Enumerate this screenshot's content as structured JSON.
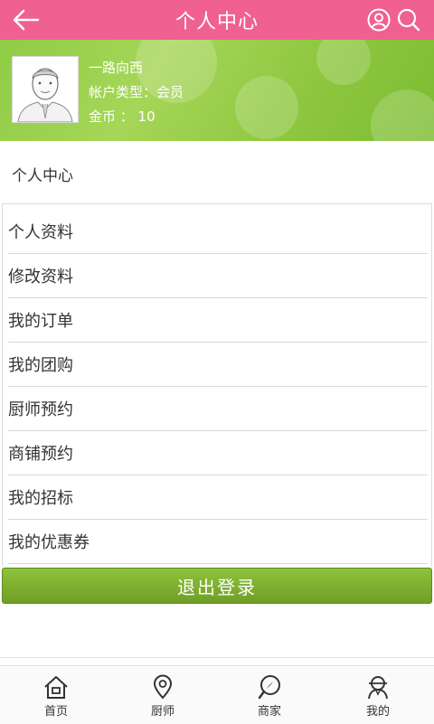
{
  "header": {
    "title": "个人中心",
    "back_icon": "back-arrow-icon",
    "user_icon": "user-circle-icon",
    "search_icon": "search-icon",
    "bg_color": "#f06090"
  },
  "profile": {
    "username": "一路向西",
    "account_type_label": "帐户类型：会员",
    "coins_label": "金币 ： 10",
    "bg_color": "#8dc63f"
  },
  "section": {
    "title": "个人中心"
  },
  "menu": {
    "items": [
      {
        "label": "个人资料"
      },
      {
        "label": "修改资料"
      },
      {
        "label": "我的订单"
      },
      {
        "label": "我的团购"
      },
      {
        "label": "厨师预约"
      },
      {
        "label": "商铺预约"
      },
      {
        "label": "我的招标"
      },
      {
        "label": "我的优惠券"
      }
    ]
  },
  "logout": {
    "label": "退出登录"
  },
  "bottom_nav": {
    "items": [
      {
        "label": "首页",
        "icon": "home-icon"
      },
      {
        "label": "厨师",
        "icon": "location-pin-icon"
      },
      {
        "label": "商家",
        "icon": "compass-search-icon"
      },
      {
        "label": "我的",
        "icon": "profile-icon"
      }
    ]
  }
}
